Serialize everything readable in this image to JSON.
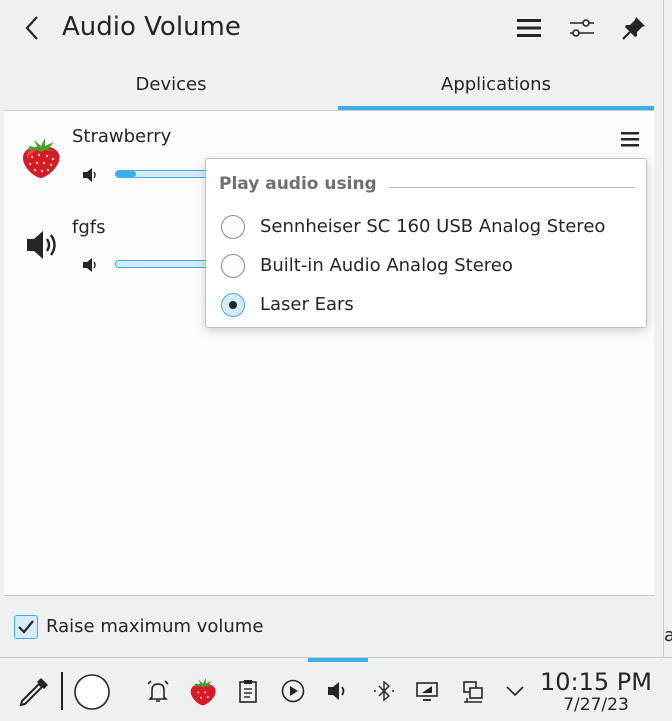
{
  "header": {
    "title": "Audio Volume",
    "icons": [
      "back-arrow-icon",
      "hamburger-menu-icon",
      "configure-icon",
      "pin-icon"
    ]
  },
  "tabs": [
    {
      "label": "Devices",
      "active": false
    },
    {
      "label": "Applications",
      "active": true
    }
  ],
  "apps": [
    {
      "name": "Strawberry",
      "icon": "strawberry-icon",
      "volume_fraction": 0.2
    },
    {
      "name": "fgfs",
      "icon": "speaker-icon",
      "volume_fraction": 0.0
    }
  ],
  "menu": {
    "section_title": "Play audio using",
    "options": [
      {
        "label": "Sennheiser SC 160 USB Analog Stereo",
        "checked": false
      },
      {
        "label": "Built-in Audio Analog Stereo",
        "checked": false
      },
      {
        "label": "Laser Ears",
        "checked": true
      }
    ]
  },
  "footer": {
    "raise_max_volume_label": "Raise maximum volume",
    "raise_max_volume_checked": true
  },
  "edge_text": "a",
  "taskbar": {
    "icons": [
      "color-picker-icon",
      "circle-icon",
      "alarm-icon",
      "strawberry-icon",
      "clipboard-icon",
      "media-play-icon",
      "volume-icon",
      "bluetooth-icon",
      "display-icon",
      "network-icon",
      "chevron-down-icon"
    ],
    "time": "10:15 PM",
    "date": "7/27/23"
  },
  "colors": {
    "accent": "#3daee9",
    "background": "#eff0f1",
    "view_background": "#fcfcfc",
    "text": "#232629"
  }
}
